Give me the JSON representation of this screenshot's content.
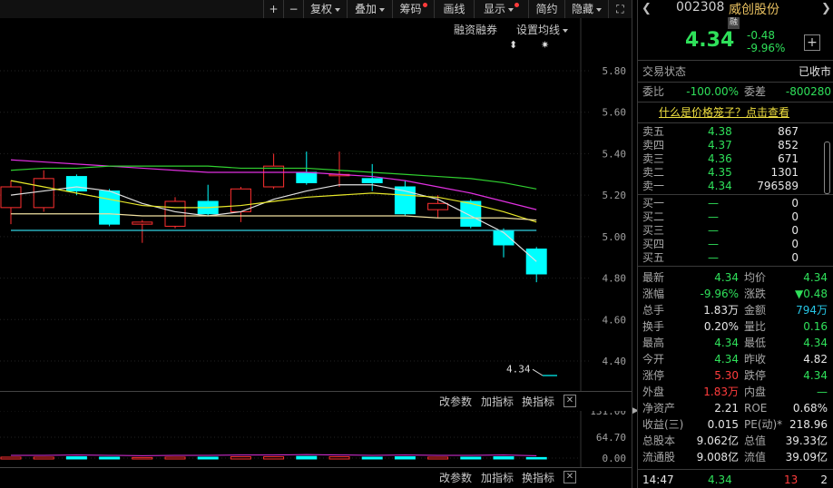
{
  "toolbar": {
    "plus": "+",
    "minus": "−",
    "fuquan": "复权",
    "diejia": "叠加",
    "chouma": "筹码",
    "huaxian": "画线",
    "xianshi": "显示",
    "jianyue": "简约",
    "yincang": "隐藏",
    "fullscreen": "⛶"
  },
  "subtoolbar": {
    "rongzi": "融资融券",
    "shezhi": "设置均线",
    "icon1": "⬍",
    "icon2": "✷"
  },
  "y_ticks": [
    "5.80",
    "5.60",
    "5.40",
    "5.20",
    "5.00",
    "4.80",
    "4.60",
    "4.40"
  ],
  "last_price_label": "4.34",
  "indicator_bar": {
    "gaicanshu": "改参数",
    "jiazhibiao": "加指标",
    "huanzhibiao": "换指标",
    "close": "✕"
  },
  "volume_ticks": [
    "131.00",
    "64.70",
    "0.00"
  ],
  "chart_data": {
    "type": "candlestick",
    "ylim": [
      4.34,
      5.84
    ],
    "candles": [
      {
        "o": 5.14,
        "c": 5.24,
        "h": 5.27,
        "l": 5.06,
        "dir": "up"
      },
      {
        "o": 5.14,
        "c": 5.28,
        "h": 5.32,
        "l": 5.12,
        "dir": "up"
      },
      {
        "o": 5.29,
        "c": 5.22,
        "h": 5.3,
        "l": 5.2,
        "dir": "down"
      },
      {
        "o": 5.22,
        "c": 5.06,
        "h": 5.23,
        "l": 5.05,
        "dir": "down"
      },
      {
        "o": 5.07,
        "c": 5.06,
        "h": 5.08,
        "l": 4.97,
        "dir": "up"
      },
      {
        "o": 5.05,
        "c": 5.17,
        "h": 5.19,
        "l": 5.04,
        "dir": "up"
      },
      {
        "o": 5.17,
        "c": 5.11,
        "h": 5.25,
        "l": 5.1,
        "dir": "down"
      },
      {
        "o": 5.12,
        "c": 5.23,
        "h": 5.24,
        "l": 5.07,
        "dir": "up"
      },
      {
        "o": 5.24,
        "c": 5.34,
        "h": 5.4,
        "l": 5.23,
        "dir": "up"
      },
      {
        "o": 5.31,
        "c": 5.26,
        "h": 5.41,
        "l": 5.25,
        "dir": "down"
      },
      {
        "o": 5.3,
        "c": 5.3,
        "h": 5.41,
        "l": 5.24,
        "dir": "up"
      },
      {
        "o": 5.28,
        "c": 5.26,
        "h": 5.35,
        "l": 5.22,
        "dir": "down"
      },
      {
        "o": 5.24,
        "c": 5.11,
        "h": 5.27,
        "l": 5.1,
        "dir": "down"
      },
      {
        "o": 5.13,
        "c": 5.16,
        "h": 5.2,
        "l": 5.09,
        "dir": "up"
      },
      {
        "o": 5.17,
        "c": 5.05,
        "h": 5.18,
        "l": 5.04,
        "dir": "down"
      },
      {
        "o": 5.03,
        "c": 4.96,
        "h": 5.04,
        "l": 4.9,
        "dir": "down"
      },
      {
        "o": 4.94,
        "c": 4.82,
        "h": 4.95,
        "l": 4.78,
        "dir": "down"
      }
    ],
    "ma_lines": [
      {
        "color": "#e0e0e0",
        "values": [
          5.2,
          5.22,
          5.24,
          5.22,
          5.16,
          5.12,
          5.1,
          5.12,
          5.18,
          5.22,
          5.25,
          5.25,
          5.22,
          5.18,
          5.1,
          5.02,
          4.88
        ]
      },
      {
        "color": "#e8e82a",
        "values": [
          5.27,
          5.24,
          5.21,
          5.18,
          5.15,
          5.14,
          5.14,
          5.15,
          5.17,
          5.19,
          5.2,
          5.21,
          5.2,
          5.19,
          5.16,
          5.12,
          5.07
        ]
      },
      {
        "color": "#e030e0",
        "values": [
          5.37,
          5.36,
          5.35,
          5.34,
          5.33,
          5.32,
          5.31,
          5.31,
          5.31,
          5.31,
          5.3,
          5.29,
          5.27,
          5.24,
          5.21,
          5.17,
          5.13
        ]
      },
      {
        "color": "#30d030",
        "values": [
          5.32,
          5.33,
          5.33,
          5.34,
          5.34,
          5.34,
          5.34,
          5.33,
          5.33,
          5.33,
          5.32,
          5.31,
          5.3,
          5.29,
          5.28,
          5.26,
          5.23
        ]
      },
      {
        "color": "#f0e0a0",
        "values": [
          5.11,
          5.11,
          5.11,
          5.11,
          5.1,
          5.1,
          5.1,
          5.1,
          5.1,
          5.1,
          5.1,
          5.1,
          5.1,
          5.09,
          5.09,
          5.09,
          5.08
        ]
      },
      {
        "color": "#30d0e0",
        "values": [
          5.03,
          5.03,
          5.03,
          5.03,
          5.03,
          5.03,
          5.03,
          5.03,
          5.03,
          5.03,
          5.03,
          5.03,
          5.03,
          5.03,
          5.03,
          5.03,
          5.03
        ]
      }
    ],
    "volume_ylim": [
      0,
      131
    ],
    "volume": [
      5,
      5,
      6,
      5,
      4,
      5,
      5,
      6,
      6,
      7,
      6,
      5,
      6,
      5,
      5,
      6,
      4
    ]
  },
  "stock": {
    "code": "002308",
    "name": "威创股份",
    "badge": "融",
    "price": "4.34",
    "change": "-0.48",
    "change_pct": "-9.96%",
    "add": "+"
  },
  "status": {
    "label": "交易状态",
    "value": "已收市"
  },
  "weibi": {
    "label": "委比",
    "value": "-100.00%",
    "label2": "委差",
    "value2": "-800280"
  },
  "price_cage_link": "什么是价格笼子？点击查看",
  "asks": [
    {
      "label": "卖五",
      "price": "4.38",
      "vol": "867"
    },
    {
      "label": "卖四",
      "price": "4.37",
      "vol": "852"
    },
    {
      "label": "卖三",
      "price": "4.36",
      "vol": "671"
    },
    {
      "label": "卖二",
      "price": "4.35",
      "vol": "1301"
    },
    {
      "label": "卖一",
      "price": "4.34",
      "vol": "796589"
    }
  ],
  "bids": [
    {
      "label": "买一",
      "price": "—",
      "vol": "0"
    },
    {
      "label": "买二",
      "price": "—",
      "vol": "0"
    },
    {
      "label": "买三",
      "price": "—",
      "vol": "0"
    },
    {
      "label": "买四",
      "price": "—",
      "vol": "0"
    },
    {
      "label": "买五",
      "price": "—",
      "vol": "0"
    }
  ],
  "stats": [
    {
      "l1": "最新",
      "v1": "4.34",
      "c1": "green",
      "l2": "均价",
      "v2": "4.34",
      "c2": "green"
    },
    {
      "l1": "涨幅",
      "v1": "-9.96%",
      "c1": "green",
      "l2": "涨跌",
      "v2": "▼0.48",
      "c2": "green"
    },
    {
      "l1": "总手",
      "v1": "1.83万",
      "c1": "white",
      "l2": "金额",
      "v2": "794万",
      "c2": "cyan"
    },
    {
      "l1": "换手",
      "v1": "0.20%",
      "c1": "white",
      "l2": "量比",
      "v2": "0.16",
      "c2": "green"
    },
    {
      "l1": "最高",
      "v1": "4.34",
      "c1": "green",
      "l2": "最低",
      "v2": "4.34",
      "c2": "green"
    },
    {
      "l1": "今开",
      "v1": "4.34",
      "c1": "green",
      "l2": "昨收",
      "v2": "4.82",
      "c2": "white"
    },
    {
      "l1": "涨停",
      "v1": "5.30",
      "c1": "red",
      "l2": "跌停",
      "v2": "4.34",
      "c2": "green"
    },
    {
      "l1": "外盘",
      "v1": "1.83万",
      "c1": "red",
      "l2": "内盘",
      "v2": "—",
      "c2": "green"
    },
    {
      "l1": "净资产",
      "v1": "2.21",
      "c1": "white",
      "l2": "ROE",
      "v2": "0.68%",
      "c2": "white"
    },
    {
      "l1": "收益(三)",
      "v1": "0.015",
      "c1": "white",
      "l2": "PE(动)*",
      "v2": "218.96",
      "c2": "white"
    },
    {
      "l1": "总股本",
      "v1": "9.062亿",
      "c1": "white",
      "l2": "总值",
      "v2": "39.33亿",
      "c2": "white"
    },
    {
      "l1": "流通股",
      "v1": "9.008亿",
      "c1": "white",
      "l2": "流值",
      "v2": "39.09亿",
      "c2": "white"
    }
  ],
  "tick": {
    "time": "14:47",
    "price": "4.34",
    "vol": "13",
    "num": "2"
  }
}
